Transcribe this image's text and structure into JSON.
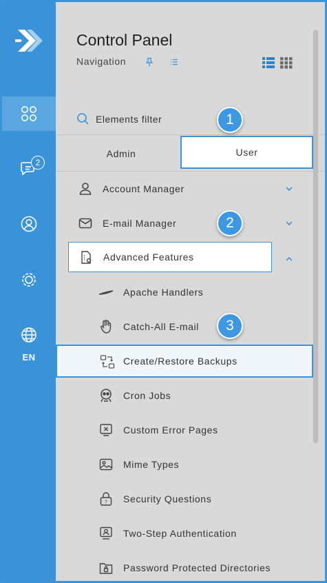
{
  "panel": {
    "title": "Control Panel",
    "subtitle": "Navigation"
  },
  "rail": {
    "chat_badge": "2",
    "language": "EN",
    "items": [
      "apps-icon",
      "chat-icon",
      "user-circle-icon",
      "settings-icon",
      "globe-icon"
    ]
  },
  "filter": {
    "placeholder": "Elements filter"
  },
  "tabs": [
    {
      "label": "Admin",
      "selected": false
    },
    {
      "label": "User",
      "selected": true
    }
  ],
  "menu": {
    "account_manager": "Account Manager",
    "email_manager": "E-mail Manager",
    "advanced_features": "Advanced Features",
    "sub_items": {
      "apache_handlers": "Apache Handlers",
      "catch_all": "Catch-All E-mail",
      "backups": "Create/Restore Backups",
      "cron_jobs": "Cron Jobs",
      "error_pages": "Custom Error Pages",
      "mime_types": "Mime Types",
      "security_questions": "Security Questions",
      "two_step": "Two-Step Authentication",
      "protected_dirs": "Password Protected Directories"
    }
  },
  "callouts": [
    "1",
    "2",
    "3"
  ],
  "colors": {
    "accent": "#3a93d8",
    "background": "#d9d9d9"
  }
}
